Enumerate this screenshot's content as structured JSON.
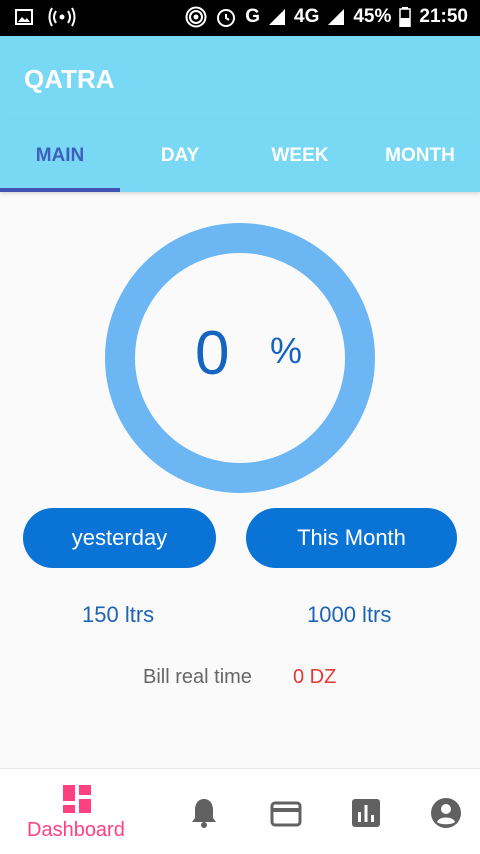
{
  "status_bar": {
    "network_g": "G",
    "network_4g": "4G",
    "battery": "45%",
    "time": "21:50"
  },
  "app": {
    "title": "QATRA"
  },
  "tabs": [
    {
      "label": "MAIN",
      "active": true
    },
    {
      "label": "DAY",
      "active": false
    },
    {
      "label": "WEEK",
      "active": false
    },
    {
      "label": "MONTH",
      "active": false
    }
  ],
  "gauge": {
    "value": "0",
    "unit": "%",
    "progress_percent": 0,
    "color": "#6cb6f3"
  },
  "buttons": {
    "yesterday": "yesterday",
    "this_month": "This Month"
  },
  "usage": {
    "yesterday": "150 ltrs",
    "this_month": "1000 ltrs"
  },
  "bill": {
    "label": "Bill real time",
    "value": "0 DZ"
  },
  "bottom_nav": {
    "items": [
      {
        "label": "Dashboard",
        "icon": "dashboard-icon",
        "active": true
      },
      {
        "label": "",
        "icon": "bell-icon",
        "active": false
      },
      {
        "label": "",
        "icon": "credit-card-icon",
        "active": false
      },
      {
        "label": "",
        "icon": "chart-icon",
        "active": false
      },
      {
        "label": "",
        "icon": "account-icon",
        "active": false
      }
    ]
  },
  "colors": {
    "accent": "#79d8f3",
    "primary": "#0a73d6",
    "active_nav": "#ff4081",
    "bill": "#e53935"
  }
}
